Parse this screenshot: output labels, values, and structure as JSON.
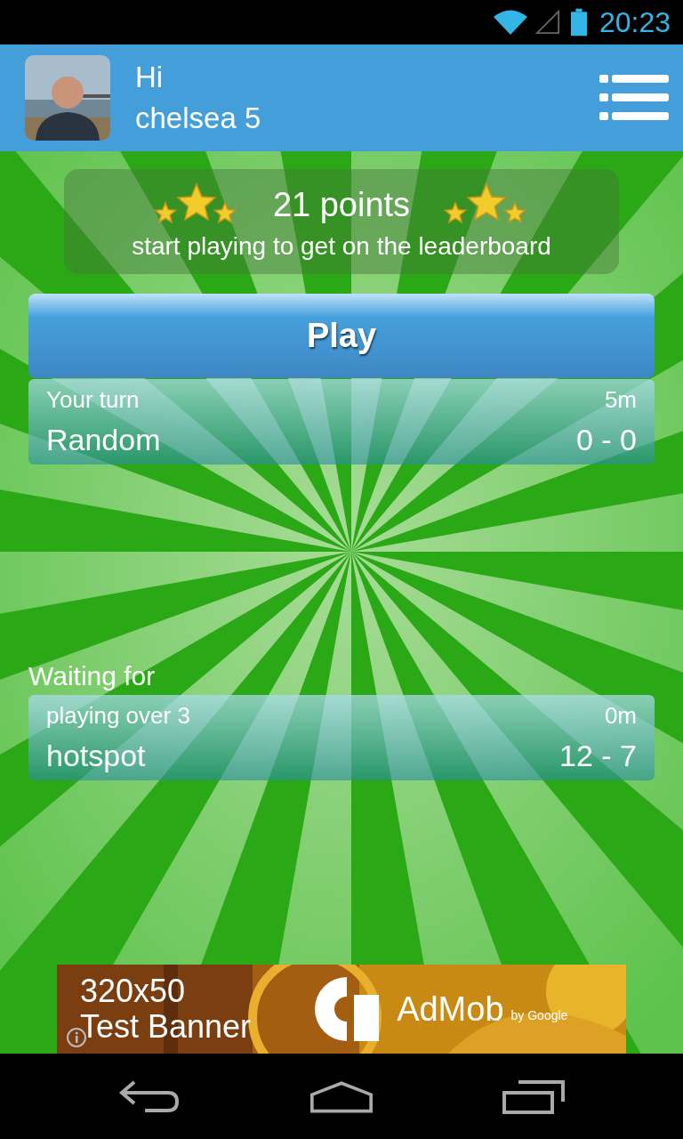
{
  "status_bar": {
    "time": "20:23"
  },
  "header": {
    "greeting": "Hi",
    "username": "chelsea 5"
  },
  "score": {
    "points": "21 points",
    "message": "start playing to get on the leaderboard"
  },
  "play_button": {
    "label": "Play"
  },
  "your_turn_games": [
    {
      "status": "Your turn",
      "time": "5m",
      "opponent": "Random",
      "score": "0 - 0"
    }
  ],
  "waiting_section": {
    "heading": "Waiting for",
    "games": [
      {
        "status": "playing over 3",
        "time": "0m",
        "opponent": "hotspot",
        "score": "12 - 7"
      }
    ]
  },
  "ad_banner": {
    "line_1": "320x50",
    "line_2": "Test Banner",
    "brand": "AdMob",
    "byline": "by Google"
  }
}
